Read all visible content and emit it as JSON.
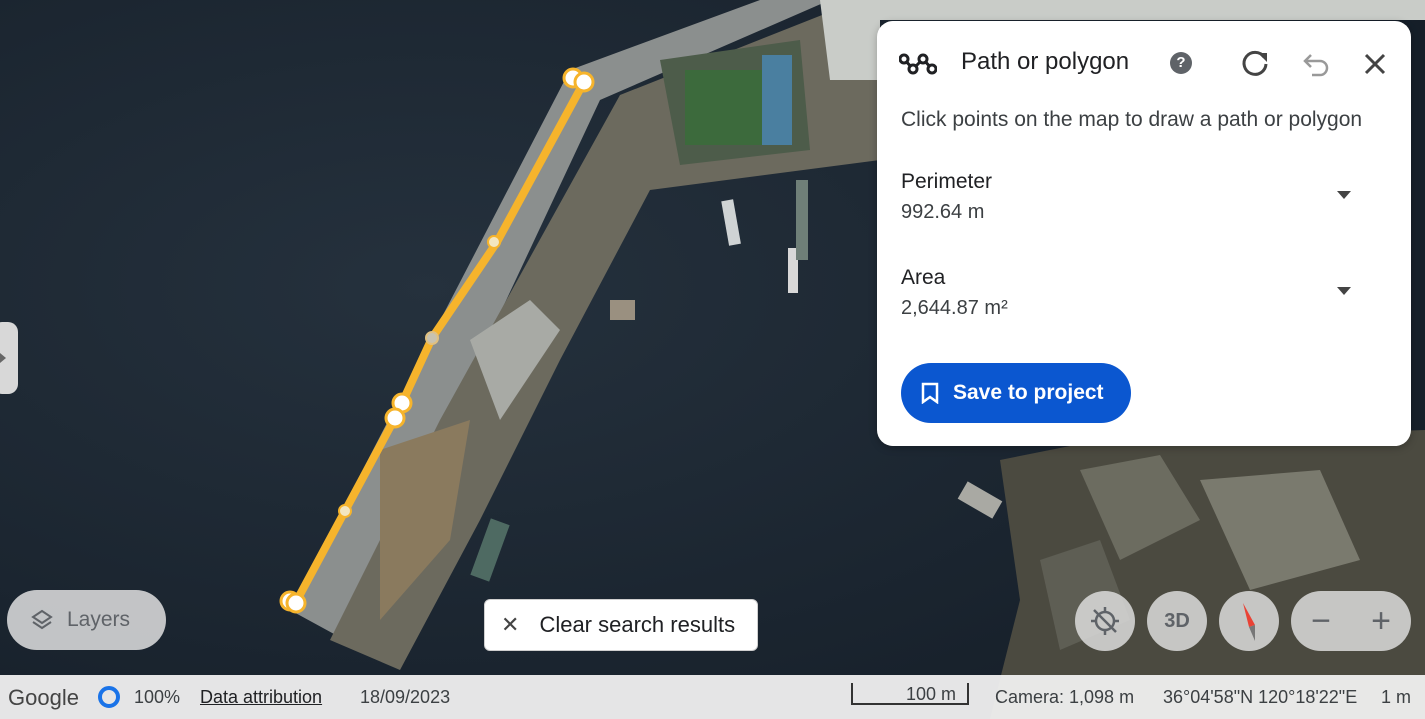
{
  "panel": {
    "title": "Path or polygon",
    "help_label": "?",
    "instruction": "Click points on the map to draw a path or polygon",
    "perimeter_label": "Perimeter",
    "perimeter_value": "992.64 m",
    "area_label": "Area",
    "area_value": "2,644.87 m²",
    "save_label": "Save to project"
  },
  "layers_label": "Layers",
  "clear_search_label": "Clear search results",
  "controls": {
    "three_d_label": "3D"
  },
  "status": {
    "logo": "Google",
    "zoom_percent": "100%",
    "data_attribution": "Data attribution",
    "date": "18/09/2023",
    "scale": "100 m",
    "camera": "Camera: 1,098 m",
    "coordinates": "36°04'58\"N 120°18'22\"E",
    "resolution": "1 m"
  },
  "colors": {
    "path": "#f6b42c",
    "water": "#1c2733",
    "save_button": "#0b57d0"
  },
  "icons": [
    "path-icon",
    "help-icon",
    "refresh-icon",
    "undo-icon",
    "close-icon",
    "bookmark-icon",
    "layers-icon",
    "close-icon",
    "location-off-icon",
    "compass-icon",
    "zoom-out-icon",
    "zoom-in-icon"
  ]
}
